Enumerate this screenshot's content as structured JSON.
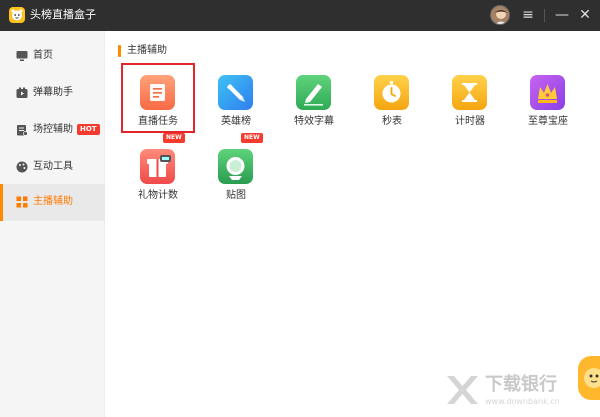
{
  "app": {
    "title": "头榜直播盒子"
  },
  "titlebar": {
    "menu_icon": "menu-icon",
    "minimize_icon": "minimize-icon",
    "close_icon": "close-icon",
    "menu_glyph": "≡",
    "minimize_glyph": "—",
    "close_glyph": "✕"
  },
  "sidebar": {
    "items": [
      {
        "label": "首页",
        "icon": "monitor-icon",
        "active": false
      },
      {
        "label": "弹幕助手",
        "icon": "video-icon",
        "active": false
      },
      {
        "label": "场控辅助",
        "icon": "clipboard-icon",
        "active": false,
        "badge": "HOT"
      },
      {
        "label": "互动工具",
        "icon": "palette-icon",
        "active": false
      },
      {
        "label": "主播辅助",
        "icon": "grid-icon",
        "active": true
      }
    ]
  },
  "main": {
    "section_title": "主播辅助",
    "tools": [
      {
        "label": "直播任务",
        "icon": "task-icon",
        "selected": true
      },
      {
        "label": "英雄榜",
        "icon": "hero-icon"
      },
      {
        "label": "特效字幕",
        "icon": "subtitle-icon"
      },
      {
        "label": "秒表",
        "icon": "stopwatch-icon"
      },
      {
        "label": "计时器",
        "icon": "timer-icon"
      },
      {
        "label": "至尊宝座",
        "icon": "throne-icon"
      },
      {
        "label": "礼物计数",
        "icon": "gift-counter-icon",
        "badge": "NEW"
      },
      {
        "label": "贴图",
        "icon": "sticker-icon",
        "badge": "NEW"
      }
    ]
  },
  "watermark": {
    "text": "下载银行",
    "sub": "www.downbank.cn"
  },
  "colors": {
    "accent": "#ff8a00",
    "titlebar": "#2f2f2f",
    "selection": "#e3262a",
    "badge": "#f53a2e"
  }
}
